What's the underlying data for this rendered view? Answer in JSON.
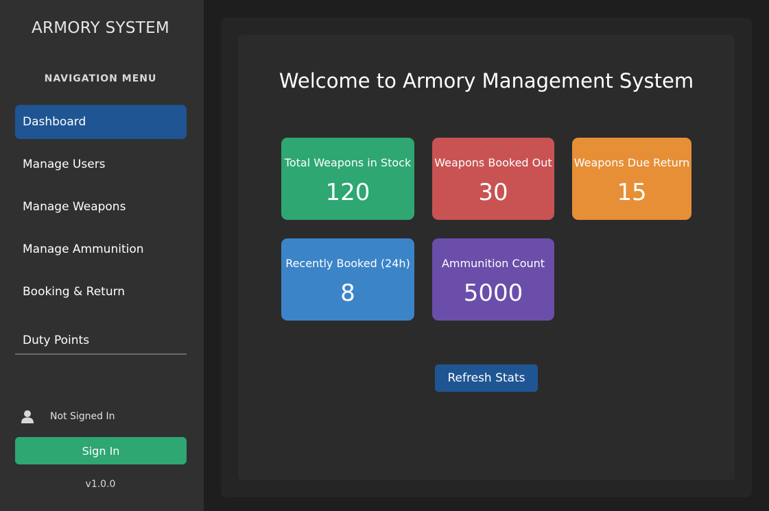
{
  "sidebar": {
    "title": "ARMORY SYSTEM",
    "nav_heading": "NAVIGATION MENU",
    "items": [
      {
        "label": "Dashboard",
        "active": true
      },
      {
        "label": "Manage Users"
      },
      {
        "label": "Manage Weapons"
      },
      {
        "label": "Manage Ammunition"
      },
      {
        "label": "Booking & Return"
      },
      {
        "label": "Duty Points"
      }
    ],
    "user_icon": "user-icon",
    "user_status": "Not Signed In",
    "signin_label": "Sign In",
    "version": "v1.0.0"
  },
  "main": {
    "welcome": "Welcome to Armory Management System",
    "cards": [
      {
        "label": "Total Weapons in Stock",
        "value": "120",
        "color": "#2ea772"
      },
      {
        "label": "Weapons Booked Out",
        "value": "30",
        "color": "#c95353"
      },
      {
        "label": "Weapons Due Return",
        "value": "15",
        "color": "#e68f37"
      },
      {
        "label": "Recently Booked (24h)",
        "value": "8",
        "color": "#3c84c8"
      },
      {
        "label": "Ammunition Count",
        "value": "5000",
        "color": "#6a4ea9"
      }
    ],
    "refresh_label": "Refresh Stats"
  },
  "colors": {
    "accent": "#1f5592",
    "sidebar_bg": "#303030",
    "page_bg": "#1e1e1e"
  }
}
